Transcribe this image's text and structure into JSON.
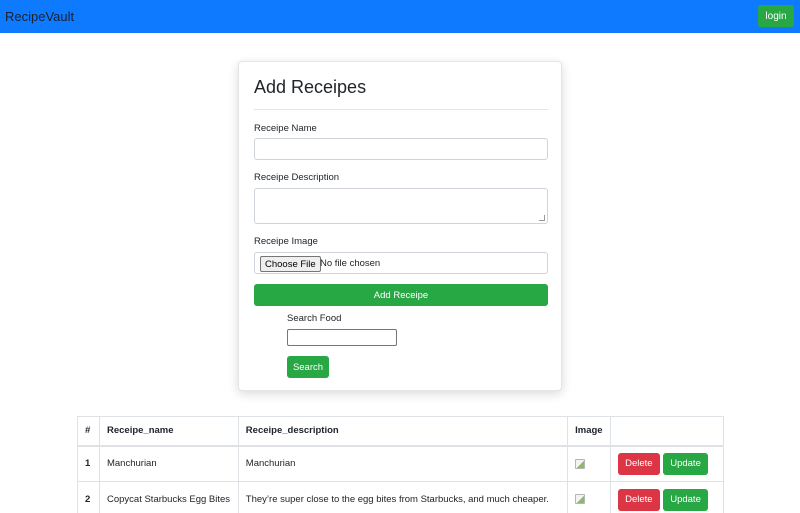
{
  "navbar": {
    "brand": "RecipeVault",
    "login_label": "login",
    "color": "#0d7aff"
  },
  "form": {
    "title": "Add Receipes",
    "name_label": "Receipe Name",
    "name_value": "",
    "description_label": "Receipe Description",
    "description_value": "",
    "image_label": "Receipe Image",
    "choose_file_label": "Choose File",
    "no_file_text": "No file chosen",
    "submit_label": "Add Receipe",
    "search_label": "Search Food",
    "search_value": "",
    "search_button_label": "Search"
  },
  "table": {
    "headers": [
      "#",
      "Receipe_name",
      "Receipe_description",
      "Image",
      ""
    ],
    "rows": [
      {
        "num": "1",
        "name": "Manchurian",
        "description": "Manchurian",
        "image_icon": "broken-image-icon",
        "delete_label": "Delete",
        "update_label": "Update"
      },
      {
        "num": "2",
        "name": "Copycat Starbucks Egg Bites",
        "description": "They’re super close to the egg bites from Starbucks, and much cheaper.",
        "image_icon": "broken-image-icon",
        "delete_label": "Delete",
        "update_label": "Update"
      }
    ]
  },
  "colors": {
    "success": "#28a745",
    "danger": "#dc3545"
  }
}
